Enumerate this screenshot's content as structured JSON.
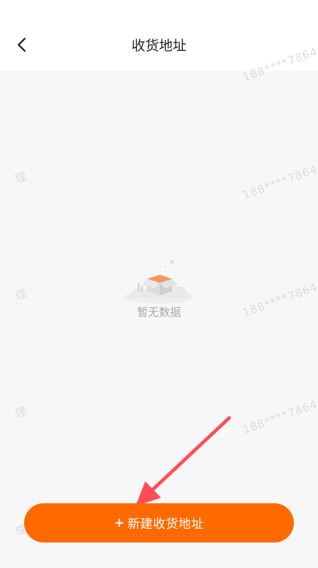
{
  "header": {
    "title": "收货地址",
    "back_icon": "chevron-left-icon"
  },
  "empty_state": {
    "illustration_icon": "empty-box-icon",
    "text": "暂无数据"
  },
  "add_button": {
    "plus": "+",
    "label": "新建收货地址",
    "color": "#ff6a00"
  },
  "watermarks": {
    "phone": "188****7864",
    "char": "理"
  },
  "annotation": {
    "arrow_color": "#ff4d5a"
  }
}
